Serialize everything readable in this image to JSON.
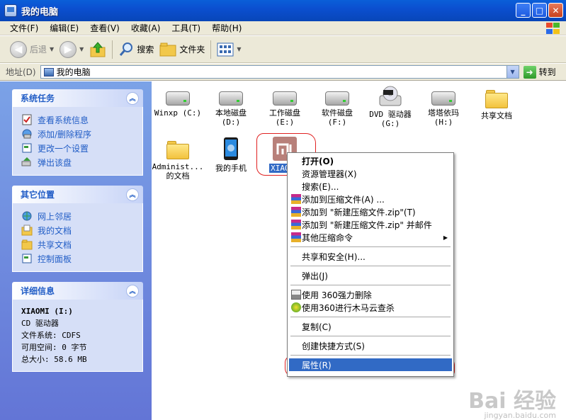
{
  "window": {
    "title": "我的电脑"
  },
  "menu": [
    "文件(F)",
    "编辑(E)",
    "查看(V)",
    "收藏(A)",
    "工具(T)",
    "帮助(H)"
  ],
  "toolbar": {
    "back": "后退",
    "search": "搜索",
    "folders": "文件夹"
  },
  "address": {
    "label": "地址(D)",
    "value": "我的电脑",
    "go": "转到"
  },
  "tasks": {
    "title": "系统任务",
    "items": [
      "查看系统信息",
      "添加/删除程序",
      "更改一个设置",
      "弹出该盘"
    ]
  },
  "places": {
    "title": "其它位置",
    "items": [
      "网上邻居",
      "我的文档",
      "共享文档",
      "控制面板"
    ]
  },
  "details": {
    "title": "详细信息",
    "name": "XIAOMI (I:)",
    "type": "CD 驱动器",
    "fs": "文件系统: CDFS",
    "free": "可用空间: 0 字节",
    "total": "总大小: 58.6 MB"
  },
  "icons": [
    {
      "label": "Winxp (C:)"
    },
    {
      "label": "本地磁盘\n(D:)"
    },
    {
      "label": "工作磁盘\n(E:)"
    },
    {
      "label": "软件磁盘\n(F:)"
    },
    {
      "label": "DVD 驱动器\n(G:)"
    },
    {
      "label": "塔塔依玛\n(H:)"
    },
    {
      "label": "共享文档"
    },
    {
      "label": "Administ...\n的文档"
    },
    {
      "label": "我的手机"
    },
    {
      "label": "XIAOMI"
    }
  ],
  "context_menu": [
    "打开(O)",
    "资源管理器(X)",
    "搜索(E)...",
    "添加到压缩文件(A) ...",
    "添加到 \"新建压缩文件.zip\"(T)",
    "添加到 \"新建压缩文件.zip\" 并邮件",
    "其他压缩命令",
    "共享和安全(H)...",
    "弹出(J)",
    "使用 360强力删除",
    "使用360进行木马云查杀",
    "复制(C)",
    "创建快捷方式(S)",
    "属性(R)"
  ],
  "watermark": {
    "main": "Bai 经验",
    "sub": "jingyan.baidu.com"
  },
  "colors": {
    "accent": "#316ac5",
    "link": "#215dc6",
    "annotation": "#e02020"
  }
}
